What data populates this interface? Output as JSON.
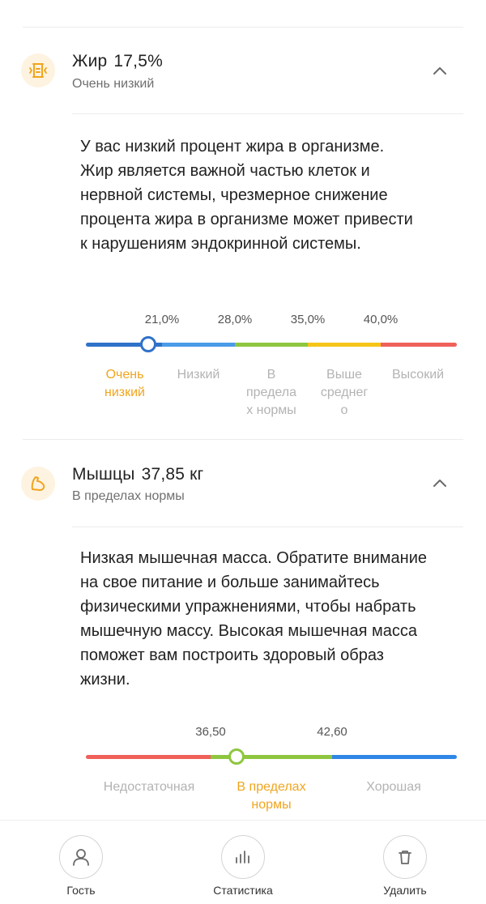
{
  "fat": {
    "title": "Жир",
    "value": "17,5%",
    "status": "Очень низкий",
    "description_lines": [
      "У вас низкий процент жира в организме.",
      "Жир является важной частью клеток и",
      "нервной системы, чрезмерное снижение",
      "процента жира в организме может привести",
      "к нарушениям эндокринной системы."
    ],
    "ticks": [
      "21,0%",
      "28,0%",
      "35,0%",
      "40,0%"
    ],
    "zones": [
      {
        "lines": [
          "Очень",
          "низкий"
        ]
      },
      {
        "lines": [
          "Низкий"
        ]
      },
      {
        "lines": [
          "В",
          "предела",
          "х нормы"
        ]
      },
      {
        "lines": [
          "Выше",
          "среднег",
          "о"
        ]
      },
      {
        "lines": [
          "Высокий"
        ]
      }
    ],
    "colors": [
      "#2f72c9",
      "#4a9be8",
      "#8ec63f",
      "#f5c518",
      "#f0605a"
    ],
    "active_zone": 0
  },
  "muscle": {
    "title": "Мышцы",
    "value": "37,85 кг",
    "status": "В пределах нормы",
    "description_lines": [
      "Низкая мышечная масса. Обратите внимание",
      "на свое питание и больше занимайтесь",
      "физическими упражнениями, чтобы набрать",
      "мышечную массу. Высокая мышечная масса",
      "поможет вам построить здоровый образ",
      "жизни."
    ],
    "ticks": [
      "36,50",
      "42,60"
    ],
    "zones": [
      {
        "lines": [
          "Недостаточная"
        ]
      },
      {
        "lines": [
          "В пределах",
          "нормы"
        ]
      },
      {
        "lines": [
          "Хорошая"
        ]
      }
    ],
    "colors": [
      "#f0605a",
      "#8ec63f",
      "#2f86e6"
    ],
    "active_zone": 1
  },
  "nav": {
    "guest": "Гость",
    "stats": "Статистика",
    "delete": "Удалить"
  },
  "accent": "#f0a51e"
}
